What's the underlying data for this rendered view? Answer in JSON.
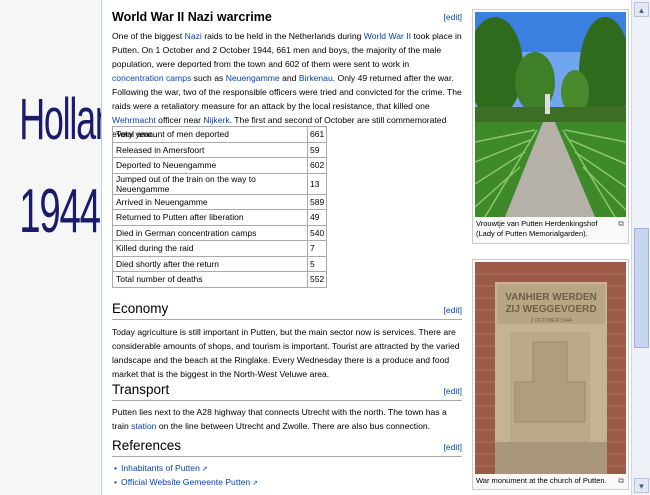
{
  "left_banner": {
    "line1": "Holland",
    "line2": "1944"
  },
  "ww2": {
    "title": "World War II Nazi warcrime",
    "edit": "[edit]",
    "p1_a": "One of the biggest ",
    "p1_nazi": "Nazi",
    "p1_b": " raids to be held in the Netherlands during ",
    "p1_ww2": "World War II",
    "p1_c": " took place in Putten. On 1 October and 2 October 1944, 661 men and boys, the majority of the male population, were deported from the town and 602 of them were sent to work in ",
    "p1_camps": "concentration camps",
    "p1_d": " such as ",
    "p1_neuen": "Neuengamme",
    "p1_e": " and ",
    "p1_birk": "Birkenau",
    "p1_f": ". Only 49 returned after the war. Following the war, two of the responsible officers were tried and convicted for the crime. The raids were a retaliatory measure for an attack by the local resistance, that killed one ",
    "p1_wehr": "Wehrmacht",
    "p1_g": " officer near ",
    "p1_nijk": "Nijkerk",
    "p1_h": ". The first and second of October are still commemorated every year."
  },
  "table": [
    {
      "label": "Total amount of men deported",
      "value": "661"
    },
    {
      "label": "Released in Amersfoort",
      "value": "59"
    },
    {
      "label": "Deported to Neuengamme",
      "value": "602"
    },
    {
      "label": "Jumped out of the train on the way to Neuengamme",
      "value": "13"
    },
    {
      "label": "Arrived in Neuengamme",
      "value": "589"
    },
    {
      "label": "Returned to Putten after liberation",
      "value": "49"
    },
    {
      "label": "Died in German concentration camps",
      "value": "540"
    },
    {
      "label": "Killed during the raid",
      "value": "7"
    },
    {
      "label": "Died shortly after the return",
      "value": "5"
    },
    {
      "label": "Total number of deaths",
      "value": "552"
    }
  ],
  "economy": {
    "title": "Economy",
    "edit": "[edit]",
    "text": "Today agriculture is still important in Putten, but the main sector now is services. There are considerable amounts of shops, and tourism is important. Tourist are attracted by the varied landscape and the beach at the Ringlake. Every Wednesday there is a produce and food market that is the biggest in the North-West Veluwe area."
  },
  "transport": {
    "title": "Transport",
    "edit": "[edit]",
    "t1": "Putten lies next to the A28 highway that connects Utrecht with the north. The town has a train ",
    "station": "station",
    "t2": " on the line between Utrecht and Zwolle. There are also bus connection."
  },
  "references": {
    "title": "References",
    "edit": "[edit]",
    "items": [
      "Inhabitants of Putten",
      "Official Website Gemeente Putten"
    ]
  },
  "images": {
    "img1_caption": "Vrouwtje van Putten Herdenkingshof (Lady of Putten Memorialgarden).",
    "img2_caption": "War monument at the church of Putten.",
    "monument_line1": "VANHIER WERDEN",
    "monument_line2": "ZIJ WEGGEVOERD",
    "monument_line3": "2 OCTOBER 1944"
  }
}
